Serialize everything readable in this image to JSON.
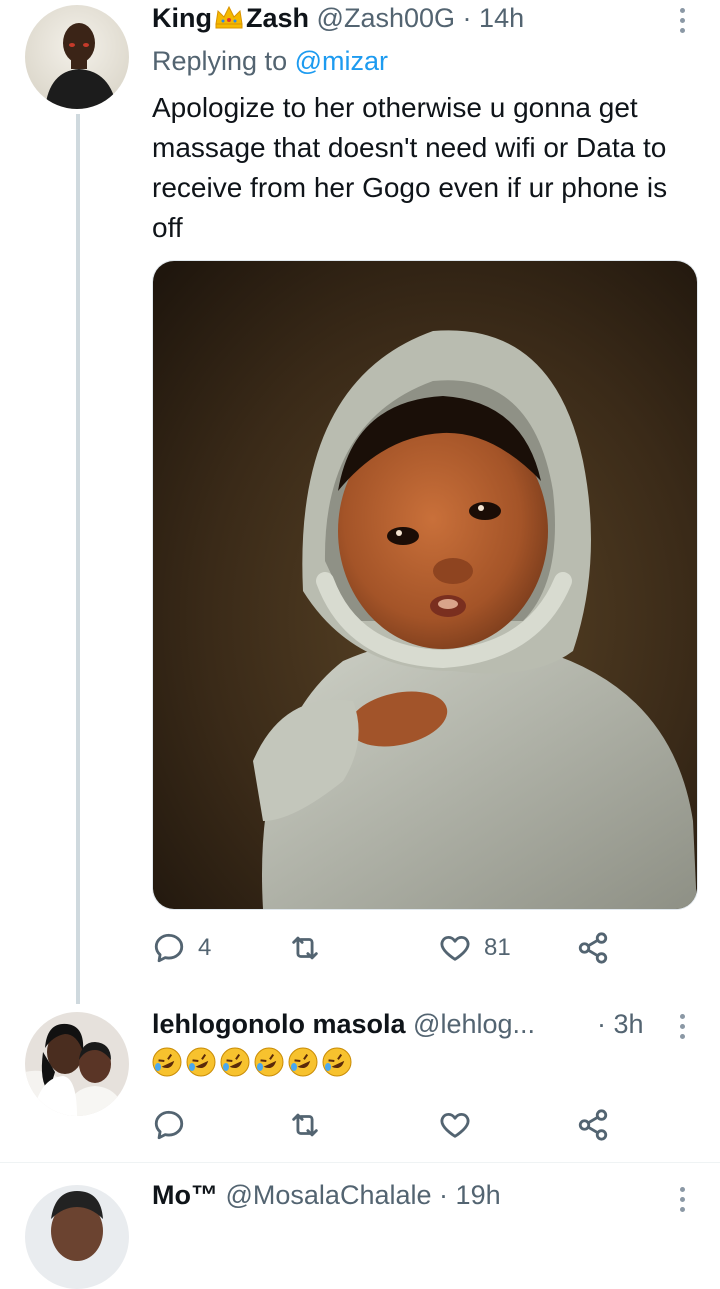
{
  "tweet1": {
    "name_part1": "King",
    "name_part2": "Zash",
    "handle": "@Zash00G",
    "dot": "·",
    "time": "14h",
    "replying_prefix": "Replying to",
    "replying_to": "@mizar",
    "text": "Apologize to her otherwise u gonna get massage that doesn't need wifi or Data to receive from her Gogo even if ur phone is off",
    "replies": "4",
    "retweets": "",
    "likes": "81",
    "avatar_icon": "avatar-man-photo",
    "crown_icon": "crown-emoji"
  },
  "tweet2": {
    "name": "lehlogonolo masola",
    "handle": "@lehlog...",
    "dot": "·",
    "time": "3h",
    "emoji_icon": "rolling-on-floor-laughing-emoji",
    "emoji_count": 6,
    "avatar_icon": "avatar-couple-photo"
  },
  "tweet3": {
    "name": "Mo™",
    "handle": "@MosalaChalale",
    "dot": "·",
    "time": "19h"
  },
  "colors": {
    "accent": "#1d9bf0",
    "muted": "#536471",
    "line": "#cfd9de"
  }
}
